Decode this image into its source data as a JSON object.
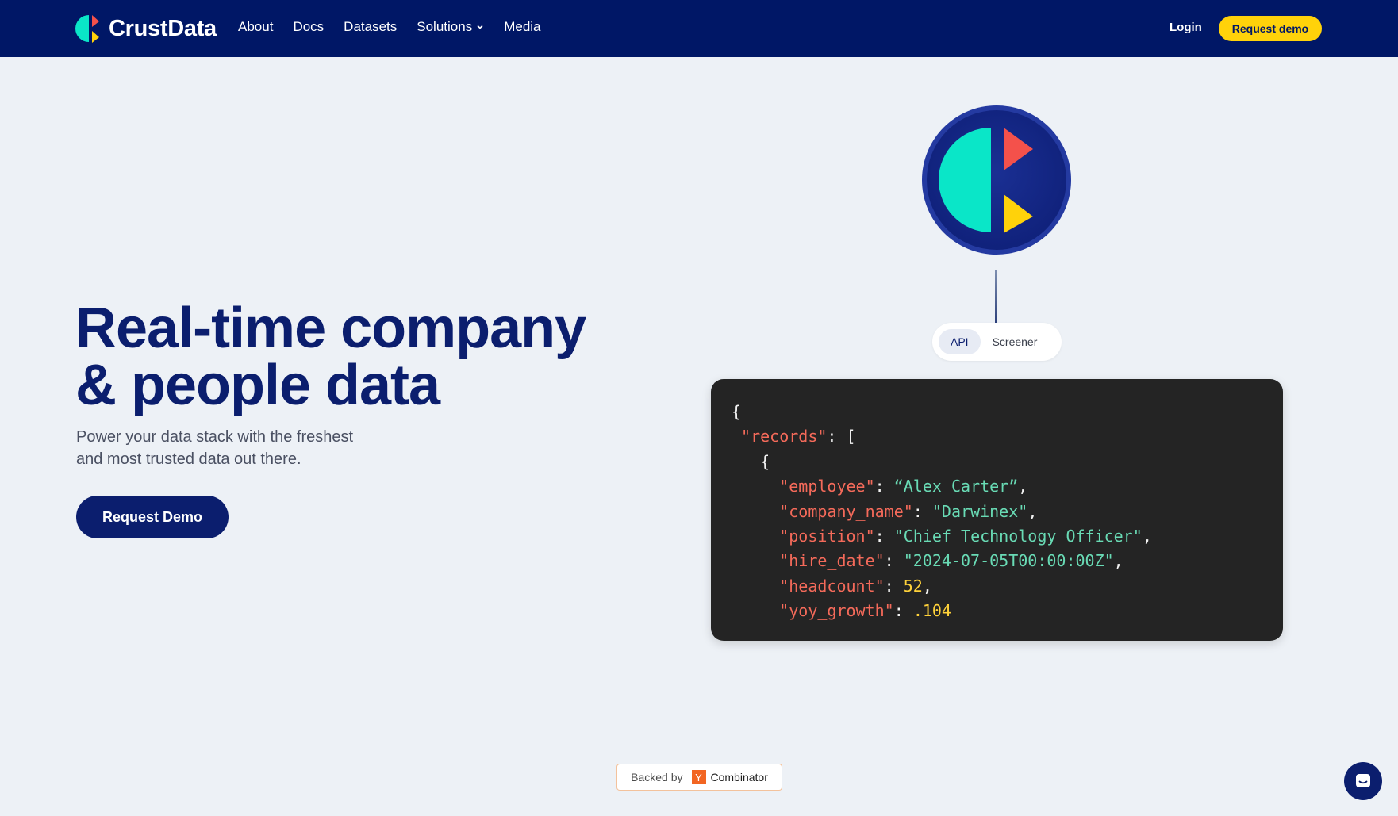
{
  "brand": {
    "name": "CrustData"
  },
  "nav": {
    "links": [
      "About",
      "Docs",
      "Datasets",
      "Solutions",
      "Media"
    ],
    "login": "Login",
    "cta": "Request demo"
  },
  "hero": {
    "title_line1": "Real-time company",
    "title_line2": "& people data",
    "subtitle_line1": "Power your data stack with the freshest",
    "subtitle_line2": "and most trusted data out there.",
    "cta": "Request Demo"
  },
  "toggle": {
    "tabs": [
      "API",
      "Screener"
    ],
    "active": "API"
  },
  "code": {
    "open_brace": "{",
    "records_key": "\"records\"",
    "records_open": ": [",
    "item_open": "{",
    "fields": [
      {
        "key": "\"employee\"",
        "value": "“Alex Carter”",
        "type": "string",
        "trail": ","
      },
      {
        "key": "\"company_name\"",
        "value": "\"Darwinex\"",
        "type": "string",
        "trail": ","
      },
      {
        "key": "\"position\"",
        "value": "\"Chief Technology Officer\"",
        "type": "string",
        "trail": ","
      },
      {
        "key": "\"hire_date\"",
        "value": "\"2024-07-05T00:00:00Z\"",
        "type": "string",
        "trail": ","
      },
      {
        "key": "\"headcount\"",
        "value": "52",
        "type": "number",
        "trail": ","
      },
      {
        "key": "\"yoy_growth\"",
        "value": ".104",
        "type": "number",
        "trail": ""
      }
    ]
  },
  "badge": {
    "backed_by": "Backed by",
    "mark": "Y",
    "name": "Combinator"
  },
  "colors": {
    "nav_bg": "#001766",
    "accent_yellow": "#ffd20a",
    "brand_navy": "#0b1e6e",
    "logo_teal": "#0ae6c8",
    "logo_red": "#f4514b",
    "logo_yellow": "#ffd20a"
  },
  "icons": {
    "chat": "chat-icon",
    "dropdown": "chevron-down-icon"
  }
}
